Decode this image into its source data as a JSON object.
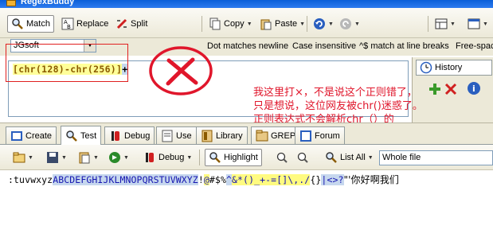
{
  "window": {
    "title": "RegexBuddy"
  },
  "toolbar": {
    "match_label": "Match",
    "replace_label": "Replace",
    "split_label": "Split",
    "copy_label": "Copy",
    "paste_label": "Paste"
  },
  "options": {
    "flavor": "JGsoft",
    "dot_matches_newline": "Dot matches newline",
    "case_insensitive": "Case insensitive",
    "caret_match": "^$ match at line breaks",
    "free_spacing": "Free-spac"
  },
  "regex": {
    "part1": "[chr(128)-chr(256)]",
    "part2": "+"
  },
  "history": {
    "label": "History"
  },
  "annotation": {
    "line1": "我这里打×，不是说这个正则错了，",
    "line2": "只是想说，这位网友被chr()迷惑了。",
    "line3": "正则表达式不会解析chr（）的"
  },
  "tabs": [
    {
      "label": "Create"
    },
    {
      "label": "Test"
    },
    {
      "label": "Debug"
    },
    {
      "label": "Use"
    },
    {
      "label": "Library"
    },
    {
      "label": "GREP"
    },
    {
      "label": "Forum"
    }
  ],
  "test_toolbar": {
    "debug_label": "Debug",
    "highlight_label": "Highlight",
    "list_all_label": "List All",
    "scope": "Whole file"
  },
  "subject": {
    "seg1": ":tuvwxyz",
    "seg2": "ABCDEFGHIJKLMNOPQRSTUVWXYZ",
    "seg3": "!",
    "seg4": "@",
    "seg5": "#$%",
    "seg6": "^",
    "seg7": "&*()_+-=[]\\,./",
    "seg8": "{}",
    "seg9": "|",
    "seg10": "<>?",
    "seg11": "\"'你好啊我们"
  },
  "colors": {
    "accent_red": "#e0162b",
    "match_blue": "#c6d7ee",
    "match_yellow": "#fffb80"
  }
}
